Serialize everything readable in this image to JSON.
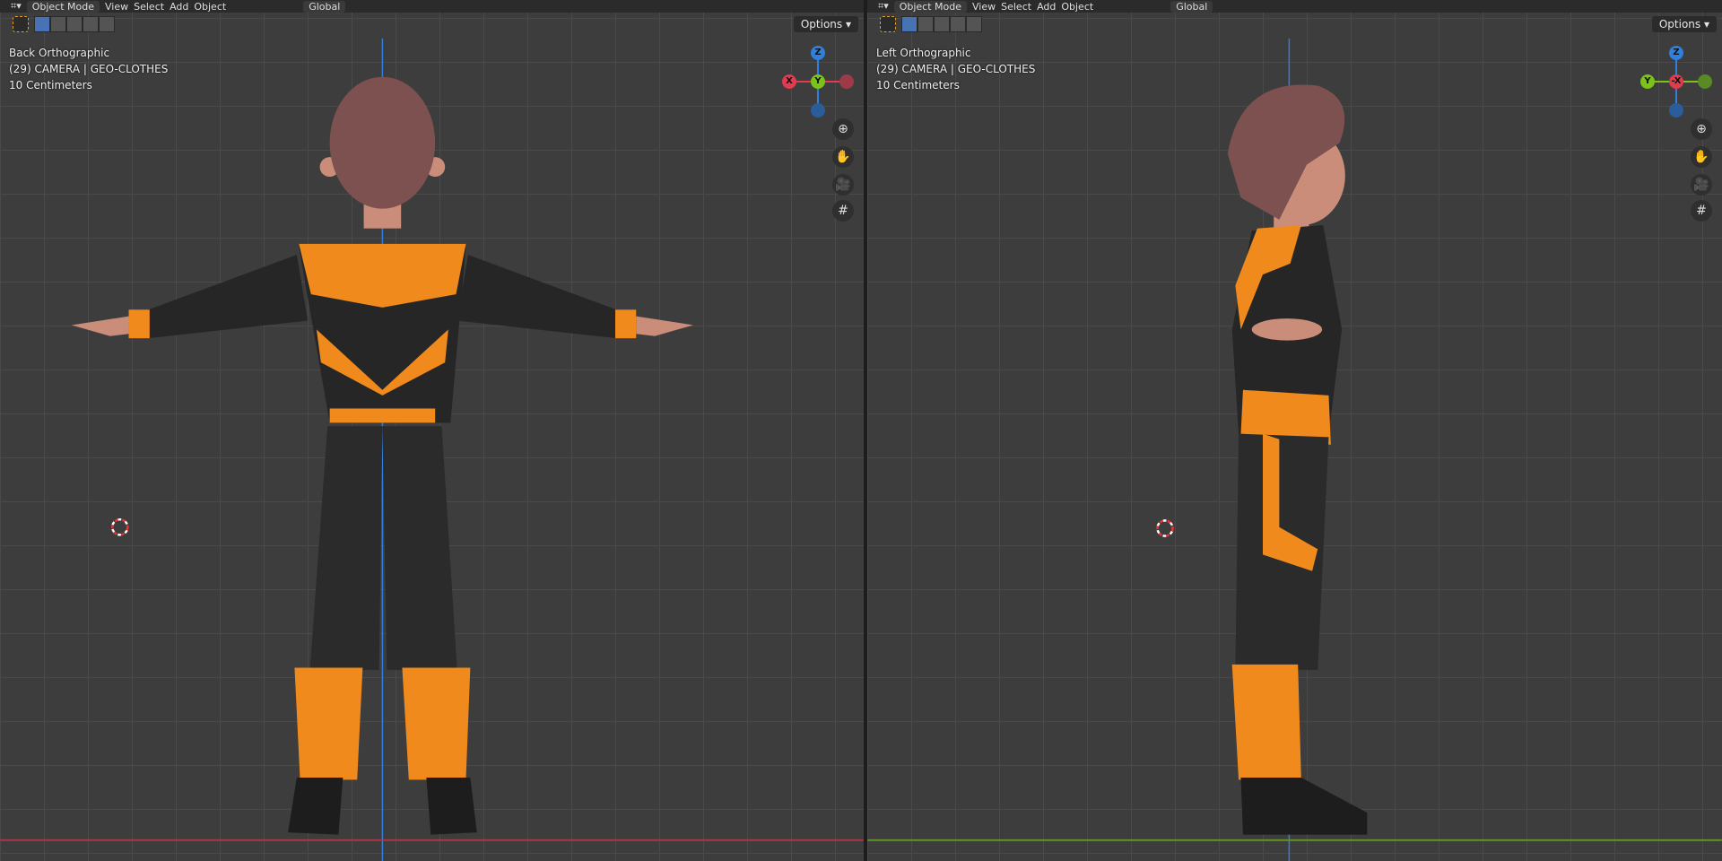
{
  "header": {
    "mode": "Object Mode",
    "menus": [
      "View",
      "Select",
      "Add",
      "Object"
    ],
    "transform_orientation": "Global",
    "options_label": "Options"
  },
  "viewports": [
    {
      "view": "Back Orthographic",
      "object": "(29) CAMERA | GEO-CLOTHES",
      "scale": "10 Centimeters",
      "gizmo": {
        "top": "Z",
        "left": "X",
        "center": "Y"
      }
    },
    {
      "view": "Left Orthographic",
      "object": "(29) CAMERA | GEO-CLOTHES",
      "scale": "10 Centimeters",
      "gizmo": {
        "top": "Z",
        "left": "Y",
        "center": "-X"
      }
    }
  ],
  "nav_icons": [
    "zoom-icon",
    "hand-pan-icon",
    "camera-icon",
    "grid-ortho-icon"
  ],
  "colors": {
    "x_axis": "#e23a4f",
    "y_axis": "#7bc31a",
    "z_axis": "#2f7fdc",
    "suit_orange": "#f08a1c",
    "suit_black": "#222222",
    "hair": "#7d5150"
  }
}
